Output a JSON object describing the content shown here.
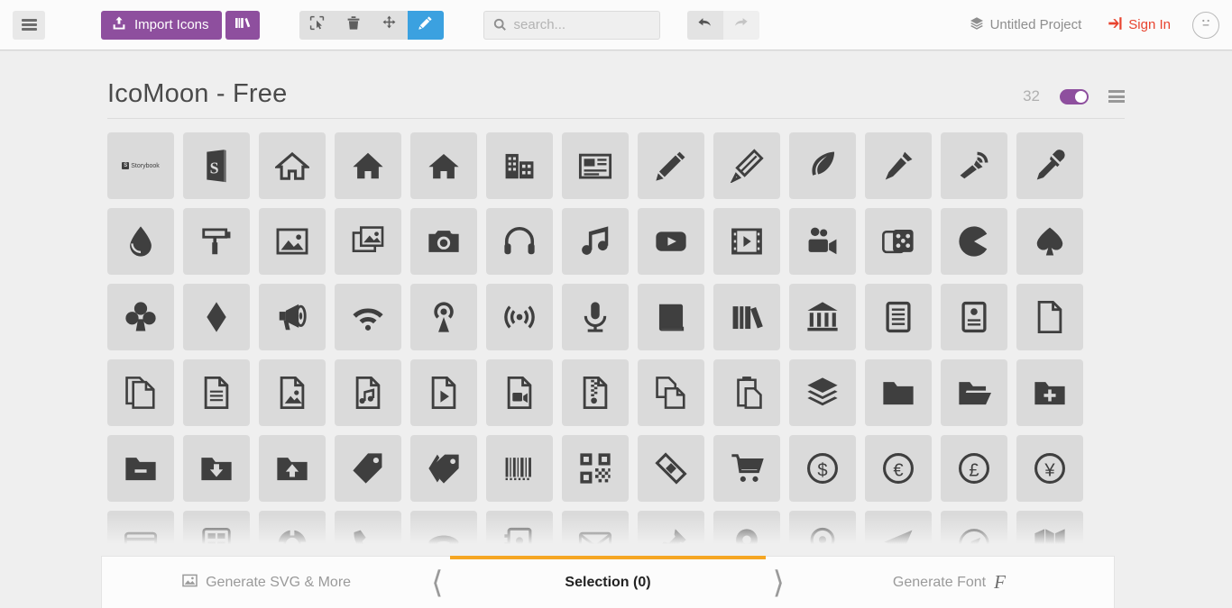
{
  "header": {
    "menu_icon": "hamburger-menu-icon",
    "import_label": "Import Icons",
    "import_icon": "upload-icon",
    "library_icon": "library-icon",
    "tools": [
      {
        "name": "select-tool",
        "icon": "cursor-select-icon",
        "active": false
      },
      {
        "name": "delete-tool",
        "icon": "trash-icon",
        "active": false
      },
      {
        "name": "move-tool",
        "icon": "move-arrows-icon",
        "active": false
      },
      {
        "name": "edit-tool",
        "icon": "pencil-icon",
        "active": true
      }
    ],
    "search": {
      "value": "",
      "placeholder": "search...",
      "icon": "search-icon"
    },
    "undo_icon": "undo-arrow-icon",
    "redo_icon": "redo-arrow-icon",
    "project_label": "Untitled Project",
    "project_icon": "layers-icon",
    "signin_label": "Sign In",
    "signin_icon": "login-icon",
    "avatar_icon": "neutral-face-avatar-icon",
    "accent_purple": "#8e4f9e",
    "accent_blue": "#3ba1e0",
    "accent_red": "#e8432e"
  },
  "set": {
    "title": "IcoMoon - Free",
    "count": "32",
    "toggle_on": true,
    "menu_icon": "list-menu-icon"
  },
  "icons": [
    {
      "name": "storybook-wordmark-icon",
      "glyph": "storybook-text"
    },
    {
      "name": "storybook-icon",
      "glyph": "storybook"
    },
    {
      "name": "home-outline-icon",
      "glyph": "home"
    },
    {
      "name": "home2-icon",
      "glyph": "home2"
    },
    {
      "name": "home3-icon",
      "glyph": "home3"
    },
    {
      "name": "office-icon",
      "glyph": "office"
    },
    {
      "name": "newspaper-icon",
      "glyph": "newspaper"
    },
    {
      "name": "pencil-icon",
      "glyph": "pencil"
    },
    {
      "name": "pencil2-icon",
      "glyph": "pencil2"
    },
    {
      "name": "quill-icon",
      "glyph": "quill"
    },
    {
      "name": "pen-icon",
      "glyph": "pen"
    },
    {
      "name": "blog-icon",
      "glyph": "blog"
    },
    {
      "name": "eyedropper-icon",
      "glyph": "eyedropper"
    },
    {
      "name": "droplet-icon",
      "glyph": "droplet"
    },
    {
      "name": "paint-format-icon",
      "glyph": "paint-format"
    },
    {
      "name": "image-icon",
      "glyph": "image"
    },
    {
      "name": "images-icon",
      "glyph": "images"
    },
    {
      "name": "camera-icon",
      "glyph": "camera"
    },
    {
      "name": "headphones-icon",
      "glyph": "headphones"
    },
    {
      "name": "music-icon",
      "glyph": "music"
    },
    {
      "name": "play-icon",
      "glyph": "play"
    },
    {
      "name": "film-icon",
      "glyph": "film"
    },
    {
      "name": "video-camera-icon",
      "glyph": "video-camera"
    },
    {
      "name": "dice-icon",
      "glyph": "dice"
    },
    {
      "name": "pacman-icon",
      "glyph": "pacman"
    },
    {
      "name": "spades-icon",
      "glyph": "spades"
    },
    {
      "name": "clubs-icon",
      "glyph": "clubs"
    },
    {
      "name": "diamonds-icon",
      "glyph": "diamonds"
    },
    {
      "name": "bullhorn-icon",
      "glyph": "bullhorn"
    },
    {
      "name": "connection-icon",
      "glyph": "connection"
    },
    {
      "name": "podcast-icon",
      "glyph": "podcast"
    },
    {
      "name": "feed-icon",
      "glyph": "feed"
    },
    {
      "name": "mic-icon",
      "glyph": "mic"
    },
    {
      "name": "book-icon",
      "glyph": "book"
    },
    {
      "name": "books-icon",
      "glyph": "books"
    },
    {
      "name": "library-icon",
      "glyph": "library"
    },
    {
      "name": "file-text-icon",
      "glyph": "file-text"
    },
    {
      "name": "profile-icon",
      "glyph": "profile"
    },
    {
      "name": "file-empty-icon",
      "glyph": "file-empty"
    },
    {
      "name": "files-empty-icon",
      "glyph": "files-empty"
    },
    {
      "name": "file-text2-icon",
      "glyph": "file-text2"
    },
    {
      "name": "file-picture-icon",
      "glyph": "file-picture"
    },
    {
      "name": "file-music-icon",
      "glyph": "file-music"
    },
    {
      "name": "file-play-icon",
      "glyph": "file-play"
    },
    {
      "name": "file-video-icon",
      "glyph": "file-video"
    },
    {
      "name": "file-zip-icon",
      "glyph": "file-zip"
    },
    {
      "name": "copy-icon",
      "glyph": "copy"
    },
    {
      "name": "paste-icon",
      "glyph": "paste"
    },
    {
      "name": "stack-icon",
      "glyph": "stack"
    },
    {
      "name": "folder-icon",
      "glyph": "folder"
    },
    {
      "name": "folder-open-icon",
      "glyph": "folder-open"
    },
    {
      "name": "folder-plus-icon",
      "glyph": "folder-plus"
    },
    {
      "name": "folder-minus-icon",
      "glyph": "folder-minus"
    },
    {
      "name": "folder-download-icon",
      "glyph": "folder-download"
    },
    {
      "name": "folder-upload-icon",
      "glyph": "folder-upload"
    },
    {
      "name": "price-tag-icon",
      "glyph": "price-tag"
    },
    {
      "name": "price-tags-icon",
      "glyph": "price-tags"
    },
    {
      "name": "barcode-icon",
      "glyph": "barcode"
    },
    {
      "name": "qrcode-icon",
      "glyph": "qrcode"
    },
    {
      "name": "ticket-icon",
      "glyph": "ticket"
    },
    {
      "name": "cart-icon",
      "glyph": "cart"
    },
    {
      "name": "coin-dollar-icon",
      "glyph": "coin-dollar"
    },
    {
      "name": "coin-euro-icon",
      "glyph": "coin-euro"
    },
    {
      "name": "coin-pound-icon",
      "glyph": "coin-pound"
    },
    {
      "name": "coin-yen-icon",
      "glyph": "coin-yen"
    },
    {
      "name": "credit-card-icon",
      "glyph": "credit-card"
    },
    {
      "name": "calculator-icon",
      "glyph": "calculator"
    },
    {
      "name": "lifebuoy-icon",
      "glyph": "lifebuoy"
    },
    {
      "name": "phone-icon",
      "glyph": "phone"
    },
    {
      "name": "phone-hang-up-icon",
      "glyph": "phone-hang-up"
    },
    {
      "name": "address-book-icon",
      "glyph": "address-book"
    },
    {
      "name": "envelop-icon",
      "glyph": "envelop"
    },
    {
      "name": "pushpin-icon",
      "glyph": "pushpin"
    },
    {
      "name": "location-icon",
      "glyph": "location"
    },
    {
      "name": "location2-icon",
      "glyph": "location2"
    },
    {
      "name": "compass-icon",
      "glyph": "compass"
    },
    {
      "name": "compass2-icon",
      "glyph": "compass2"
    },
    {
      "name": "map-icon",
      "glyph": "map"
    }
  ],
  "bottombar": {
    "left_label": "Generate SVG & More",
    "left_icon": "image-icon",
    "center_label": "Selection (0)",
    "right_label": "Generate Font",
    "right_icon": "font-f-icon",
    "accent": "#f5a623"
  }
}
